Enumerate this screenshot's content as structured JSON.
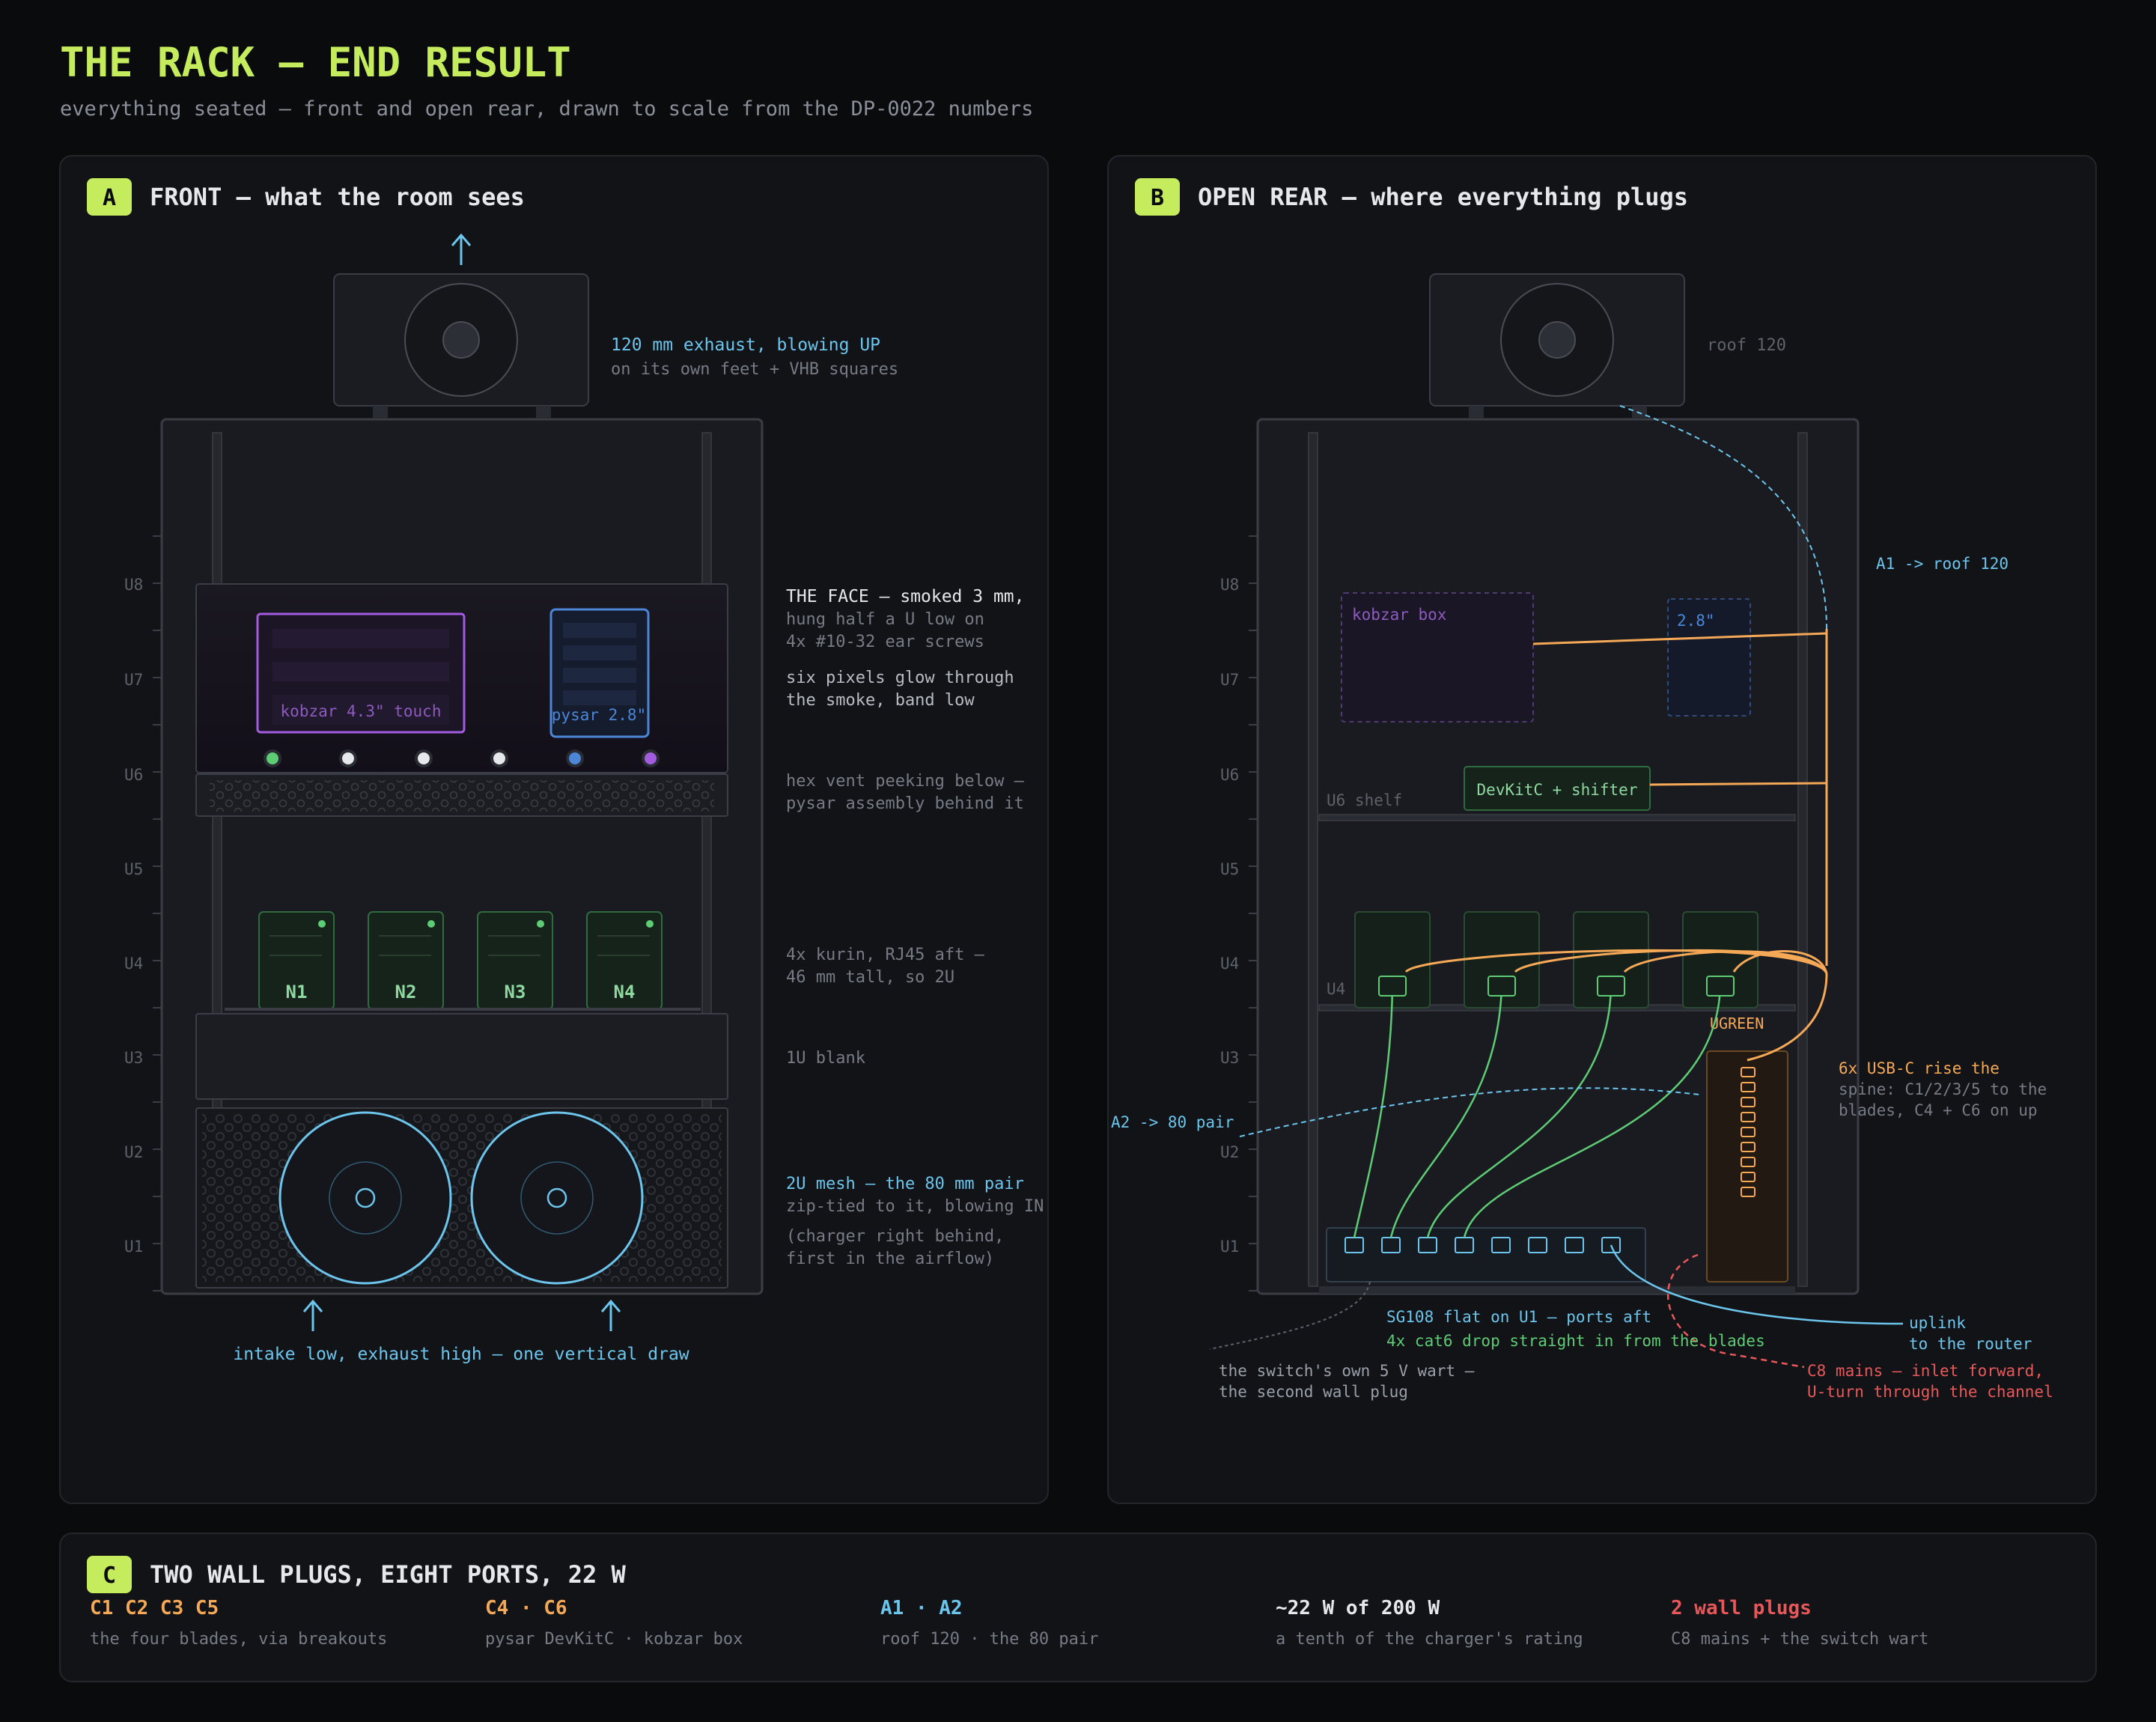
{
  "header": {
    "title": "THE RACK — END RESULT",
    "subtitle": "everything seated — front and open rear, drawn to scale from the DP-0022 numbers"
  },
  "colors": {
    "lime": "#c5ec5c",
    "cyan": "#6cc5ec",
    "orange": "#f5a957",
    "green": "#5ecb75",
    "red": "#e8585a",
    "purple": "#a35ce0",
    "blue": "#4c86d8",
    "grey": "#767b85"
  },
  "front": {
    "badge": "A",
    "title": "FRONT — what the room sees",
    "units": [
      "U8",
      "U7",
      "U6",
      "U5",
      "U4",
      "U3",
      "U2",
      "U1"
    ],
    "kobzar_label": "kobzar 4.3\" touch",
    "pysar_label": "pysar 2.8\"",
    "nodes": [
      "N1",
      "N2",
      "N3",
      "N4"
    ],
    "exhaust": {
      "title": "120 mm exhaust, blowing UP",
      "sub": "on its own feet + VHB squares"
    },
    "face": {
      "title": "THE FACE — smoked 3 mm,",
      "line1": "hung half a U low on",
      "line2": "4x #10-32 ear screws",
      "glow1": "six pixels glow through",
      "glow2": "the smoke, band low"
    },
    "hexvent": {
      "line1": "hex vent peeking below —",
      "line2": "pysar assembly behind it"
    },
    "kurin": {
      "line1": "4x kurin, RJ45 aft —",
      "line2": "46 mm tall, so 2U"
    },
    "blank": "1U blank",
    "mesh": {
      "title": "2U mesh — the 80 mm pair",
      "sub": "zip-tied to it, blowing IN",
      "note1": "(charger right behind,",
      "note2": "first in the airflow)"
    },
    "intake": "intake low, exhaust high — one vertical draw"
  },
  "rear": {
    "badge": "B",
    "title": "OPEN REAR — where everything plugs",
    "units": [
      "U8",
      "U7",
      "U6",
      "U5",
      "U4",
      "U3",
      "U2",
      "U1"
    ],
    "roof": "roof 120",
    "kobzar_box": "kobzar box",
    "pysar_box": "2.8\"",
    "devkit": "DevKitC + shifter",
    "u6_shelf": "U6 shelf",
    "u4": "U4",
    "ugreen": "UGREEN",
    "a1": "A1 -> roof 120",
    "a2": "A2 -> 80 pair",
    "usbc": {
      "title": "6x USB-C rise the",
      "line1": "spine: C1/2/3/5 to the",
      "line2": "blades, C4 + C6 on up"
    },
    "switch": {
      "title": "SG108 flat on U1 — ports aft",
      "sub": "4x cat6 drop straight in from the blades"
    },
    "wart": {
      "line1": "the switch's own 5 V wart —",
      "line2": "the second wall plug"
    },
    "uplink": {
      "line1": "uplink",
      "line2": "to the router"
    },
    "mains": {
      "line1": "C8 mains — inlet forward,",
      "line2": "U-turn through the channel"
    }
  },
  "summary": {
    "badge": "C",
    "title": "TWO WALL PLUGS, EIGHT PORTS, 22 W",
    "items": [
      {
        "value": "C1 C2 C3 C5",
        "desc": "the four blades, via breakouts",
        "color": "#f5a957"
      },
      {
        "value": "C4 · C6",
        "desc": "pysar DevKitC · kobzar box",
        "color": "#f5a957"
      },
      {
        "value": "A1 · A2",
        "desc": "roof 120 · the 80 pair",
        "color": "#6cc5ec"
      },
      {
        "value": "~22 W of 200 W",
        "desc": "a tenth of the charger's rating",
        "color": "#e6e8ec"
      },
      {
        "value": "2 wall plugs",
        "desc": "C8 mains + the switch wart",
        "color": "#e8585a"
      }
    ]
  }
}
